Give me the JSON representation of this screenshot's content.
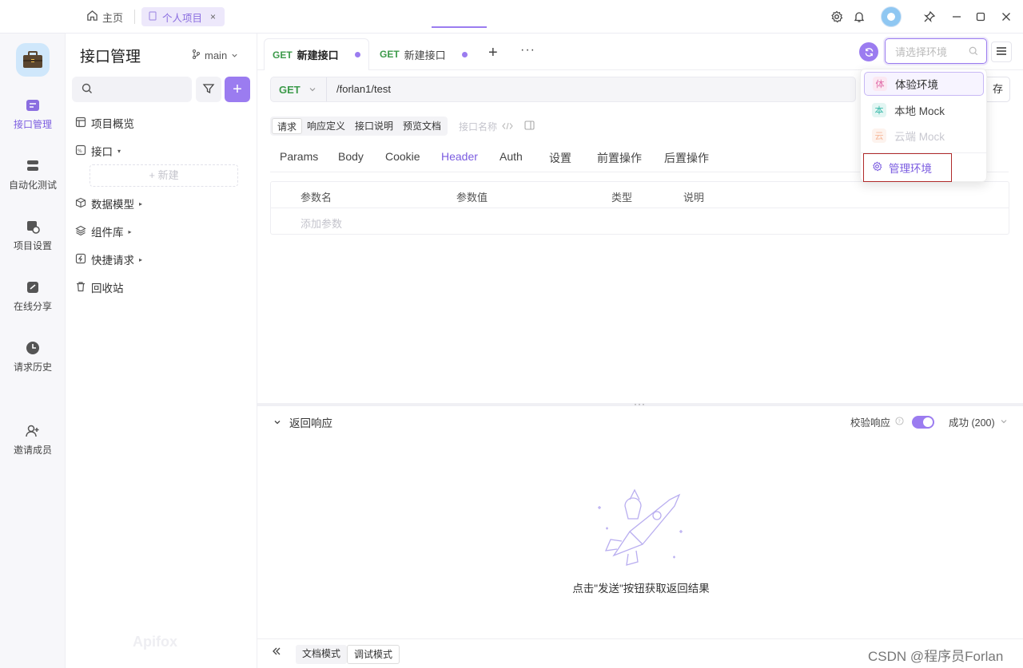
{
  "titlebar": {
    "home_label": "主页",
    "project_tab": "个人项目",
    "close_glyph": "×"
  },
  "rail": {
    "items": [
      {
        "label": "接口管理",
        "icon": "api-icon",
        "active": true
      },
      {
        "label": "自动化测试",
        "icon": "automation-icon"
      },
      {
        "label": "项目设置",
        "icon": "project-settings-icon"
      },
      {
        "label": "在线分享",
        "icon": "share-icon"
      },
      {
        "label": "请求历史",
        "icon": "history-icon"
      },
      {
        "label": "邀请成员",
        "icon": "invite-member-icon"
      }
    ]
  },
  "sidebar": {
    "title": "接口管理",
    "branch": "main",
    "new_label": "+ 新建",
    "tree": [
      {
        "label": "项目概览",
        "icon": "overview-icon"
      },
      {
        "label": "接口",
        "icon": "api-folder-icon",
        "caret": "▾"
      },
      {
        "label": "数据模型",
        "icon": "model-icon",
        "caret": "▸"
      },
      {
        "label": "组件库",
        "icon": "component-icon",
        "caret": "▸"
      },
      {
        "label": "快捷请求",
        "icon": "quick-request-icon",
        "caret": "▸"
      },
      {
        "label": "回收站",
        "icon": "trash-icon"
      }
    ],
    "watermark": "Apifox"
  },
  "tabs": [
    {
      "method": "GET",
      "name": "新建接口",
      "active": true
    },
    {
      "method": "GET",
      "name": "新建接口",
      "active": false
    }
  ],
  "env": {
    "placeholder": "请选择环境",
    "options": [
      {
        "badge": "体",
        "label": "体验环境",
        "badge_color": "#e06aa8",
        "badge_bg": "#fbe8f2",
        "selected": true
      },
      {
        "badge": "本",
        "label": "本地 Mock",
        "badge_color": "#35b7a8",
        "badge_bg": "#e3f6f3"
      },
      {
        "badge": "云",
        "label": "云端 Mock",
        "badge_color": "#f08a5d",
        "badge_bg": "#fdeee6",
        "disabled": true
      }
    ],
    "manage": "管理环境"
  },
  "request": {
    "method": "GET",
    "url": "/forlan1/test",
    "save": "存"
  },
  "subtabs": [
    "请求",
    "响应定义",
    "接口说明",
    "预览文档"
  ],
  "api_name_placeholder": "接口名称",
  "param_tabs": [
    "Params",
    "Body",
    "Cookie",
    "Header",
    "Auth",
    "设置",
    "前置操作",
    "后置操作"
  ],
  "param_table": {
    "columns": [
      "参数名",
      "参数值",
      "类型",
      "说明"
    ],
    "add_placeholder": "添加参数"
  },
  "response": {
    "title": "返回响应",
    "validate": "校验响应",
    "status": "成功 (200)",
    "empty_text": "点击\"发送\"按钮获取返回结果"
  },
  "bottom": {
    "doc_mode": "文档模式",
    "debug_mode": "调试模式",
    "corner": "CSDN @程序员Forlan"
  },
  "colors": {
    "accent": "#9b7cf0",
    "get": "#3c9a4a"
  }
}
